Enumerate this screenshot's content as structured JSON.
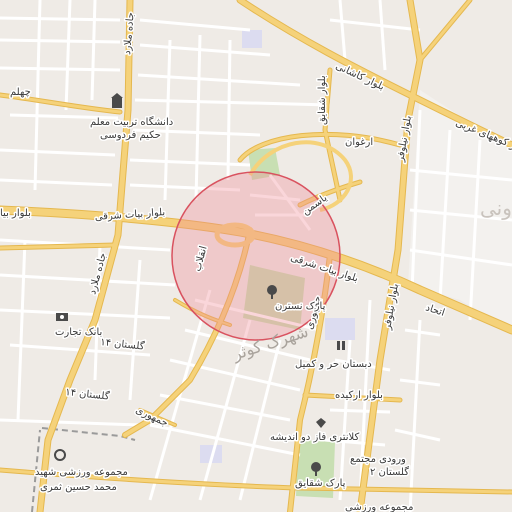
{
  "map": {
    "background": "#efebe6",
    "colors": {
      "major_road": "#f5d27a",
      "major_road_edge": "#e5b84f",
      "minor_road": "#ffffff",
      "park": "#c8dfb3",
      "rail": "#9a9a9a",
      "circle_fill": "#f08a95",
      "circle_stroke": "#d9525f"
    },
    "highlight_circle": {
      "label": ""
    },
    "road_labels": {
      "jadeh_malard_top": "جاده ملارد",
      "jadeh_malard_left": "جاده ملارد",
      "bolvar_kashani": "بلوار کاشانی",
      "bolvar_shaghayegh": "بلوار شقایق",
      "bolvar_kohhaye_gharbi": "بلوار کوههای غربی",
      "arghavan": "ارغوان",
      "bolvar_niloufar_top": "بلوار نیلوفر",
      "bolvar_niloufar_bottom": "بلوار نیلوفر",
      "bolvar_bayat_sharghi_left": "بلوار بیات شرقی",
      "bolvar_bayat_sharghi_right": "بلوار بیات شرقی",
      "bolvar_bayat_edge": "بلوار بیا",
      "yasaman": "یاسمن",
      "enghelab": "انقلاب",
      "jomhouri_1": "جمهوری",
      "jomhouri_2": "جمهوری",
      "jomhouri_3": "جمهوری",
      "etehad": "اتحاد",
      "golestan_14_a": "گلستان ۱۴",
      "golestan_14_b": "گلستان ۱۴",
      "golestan_2": "گلستان ۲",
      "bolvar_arkideh": "بلوار ارکیده",
      "chehelm": "چهلم"
    },
    "poi_labels": {
      "university_line1": "دانشگاه تربیت معلم",
      "university_line2": "حکیم فردوسی",
      "park_nastaran": "پارک نسترن",
      "bank_tejarat": "بانک تجارت",
      "school_line1": "دبستان حر و کمیل",
      "klantari": "کلانتری فاز دو اندیشه",
      "complex_line1": "ورودی مجتمع",
      "complex_line2": "گلستان ۲",
      "park_shaghayegh": "پارک شقایق",
      "sport_line1": "مجموعه ورزشی شهید",
      "sport_line2": "محمد حسین ثمری",
      "bottom_partial": "مجموعه ورزشی"
    },
    "area_labels": {
      "shahrak_kowsar": "شهرک کوثر",
      "edge_partial": "ونی"
    },
    "icons": [
      "university-icon",
      "park-icon",
      "bank-icon",
      "school-icon",
      "police-icon",
      "sport-icon"
    ]
  }
}
